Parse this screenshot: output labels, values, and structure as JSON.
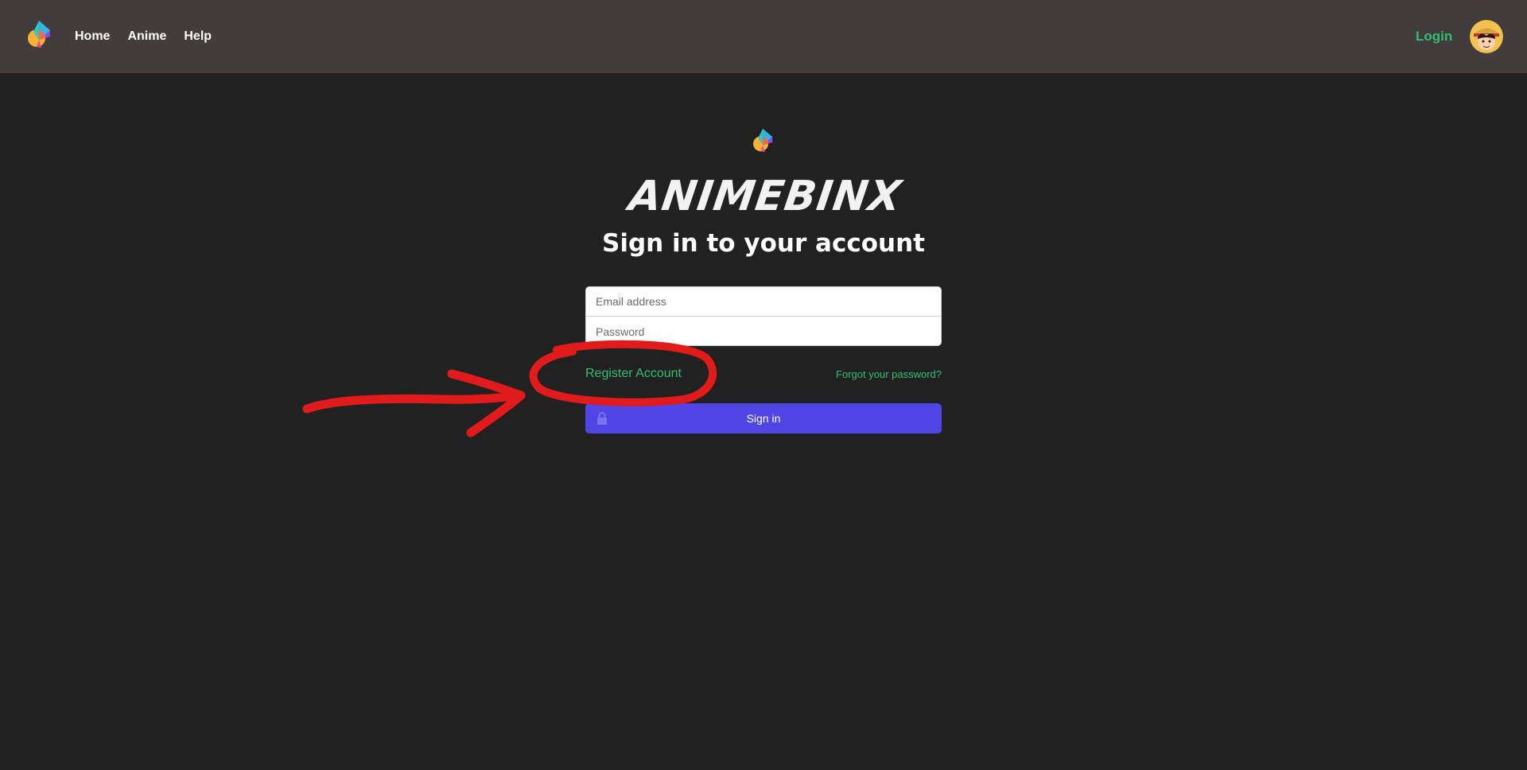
{
  "nav": {
    "logo_icon": "app-logo-icon",
    "links": [
      {
        "label": "Home"
      },
      {
        "label": "Anime"
      },
      {
        "label": "Help"
      }
    ],
    "login_label": "Login",
    "avatar_icon": "user-avatar"
  },
  "login": {
    "logo_icon": "app-logo-icon",
    "wordmark": "ANIMEBINX",
    "heading": "Sign in to your account",
    "email_placeholder": "Email address",
    "password_placeholder": "Password",
    "register_label": "Register Account",
    "forgot_label": "Forgot your password?",
    "signin_label": "Sign in",
    "lock_icon": "lock-icon"
  },
  "annotation": {
    "type": "hand-drawn red circle and arrow pointing at Register Account",
    "color": "#e11b1b"
  },
  "colors": {
    "navbar": "#423d3c",
    "background": "#222121",
    "accent_green": "#2fbf71",
    "button": "#4f46e5"
  }
}
